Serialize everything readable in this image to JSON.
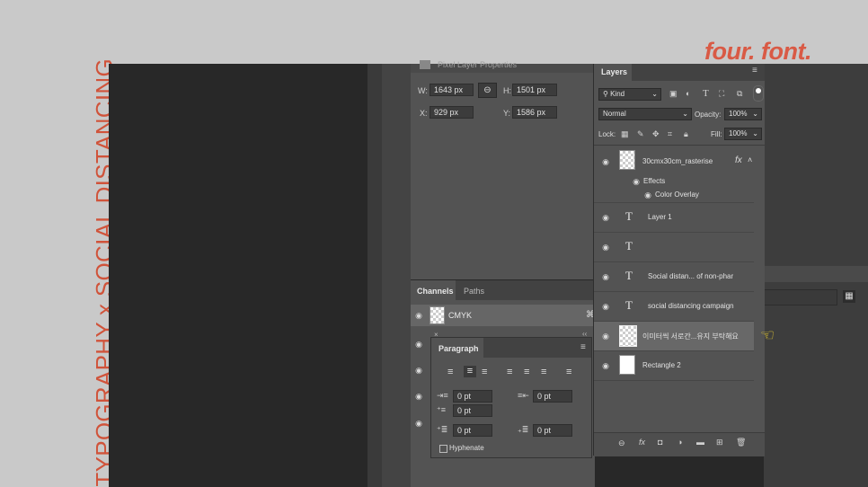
{
  "slide": {
    "vertical_title": "TYPOGRAPHY x SOCIAL DISTANCING",
    "logo": "four. font."
  },
  "properties": {
    "header": "Pixel Layer Properties",
    "w_label": "W:",
    "w_value": "1643 px",
    "h_label": "H:",
    "h_value": "1501 px",
    "x_label": "X:",
    "x_value": "929 px",
    "y_label": "Y:",
    "y_value": "1586 px"
  },
  "channels": {
    "tabs": [
      "Channels",
      "Paths"
    ],
    "row_label": "CMYK"
  },
  "paragraph": {
    "title": "Paragraph",
    "indent_left": "0 pt",
    "indent_right": "0 pt",
    "first_line": "0 pt",
    "space_before": "0 pt",
    "space_after": "0 pt",
    "hyphenate_label": "Hyphenate"
  },
  "layers": {
    "tab": "Layers",
    "kind_label": "Kind",
    "blend_mode": "Normal",
    "opacity_label": "Opacity:",
    "opacity_value": "100%",
    "lock_label": "Lock:",
    "fill_label": "Fill:",
    "fill_value": "100%",
    "items": [
      {
        "name": "30cmx30cm_rasterise",
        "fx": "fx"
      },
      {
        "name": "Effects"
      },
      {
        "name": "Color Overlay"
      },
      {
        "name": "Layer 1"
      },
      {
        "name": ""
      },
      {
        "name": "Social distan... of non-phar"
      },
      {
        "name": "social distancing campaign"
      },
      {
        "name": "이미터씩 서로간...유지 부탁해요"
      },
      {
        "name": "Rectangle 2"
      }
    ]
  },
  "colors": {
    "accent": "#d0533a",
    "panel": "#535353",
    "dark": "#282828"
  }
}
